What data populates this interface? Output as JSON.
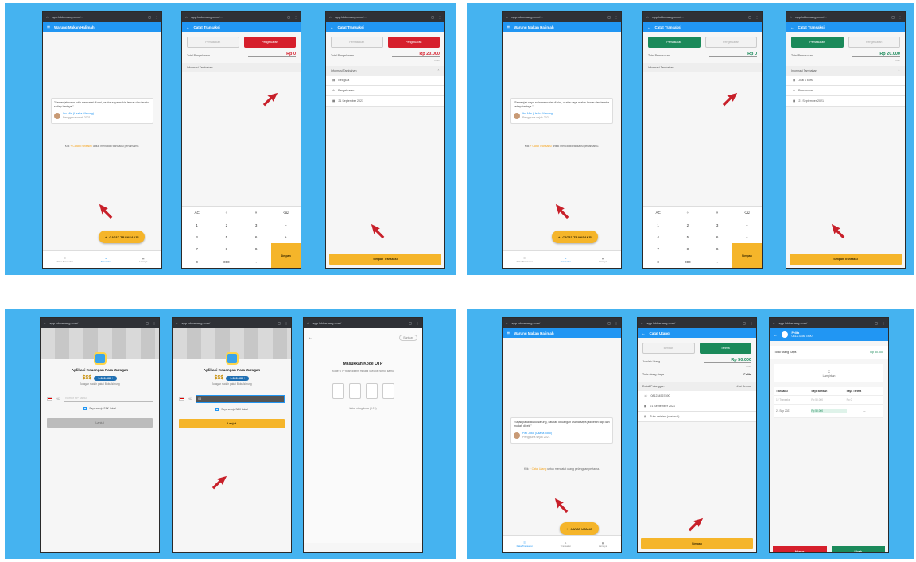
{
  "panel1": {
    "screen1": {
      "url": "app.lokkeuang.com/...",
      "title": "Warung Makan Halimah",
      "quote": "\"Semenjak saya rutin mencatat di sini, usaha saya makin lancar dan teratur setiap harinya.\"",
      "quote_user": "Ibu Mia (Usaha Warung)",
      "quote_user_sub": "Pengguna sejak 2021",
      "note_prefix": "Klik",
      "note_highlight": "+ Catat Transaksi",
      "note_suffix": "untuk mencatat transaksi pertamamu.",
      "fab_label": "CATAT TRANSAKSI",
      "nav": [
        "Data Transaksi",
        "Transaksi",
        "Lainnya"
      ]
    },
    "screen2": {
      "url": "app.lokkeuang.com/...",
      "title": "Catat Transaksi",
      "tab_off": "Pemasukan",
      "tab_on": "Pengeluaran",
      "amount_label": "Total Pengeluaran",
      "amount": "Rp 0",
      "section": "Informasi Tambahan",
      "keys": [
        "AC",
        "÷",
        "×",
        "⌫",
        "1",
        "2",
        "3",
        "−",
        "4",
        "5",
        "6",
        "+",
        "7",
        "8",
        "9",
        "0",
        "000",
        "."
      ],
      "save": "Simpan"
    },
    "screen3": {
      "url": "app.lokkeuang.com/...",
      "title": "Catat Transaksi",
      "tab_off": "Pemasukan",
      "tab_on": "Pengeluaran",
      "amount_label": "Total Pengeluaran",
      "amount": "Rp 20.000",
      "amount_hint": "Ubah",
      "section": "Informasi Tambahan",
      "fields": [
        "Beli gula",
        "Pengeluaran",
        "21 September 2021"
      ],
      "save": "Simpan Transaksi"
    }
  },
  "panel2": {
    "screen1": {
      "url": "app.lokkeuang.com/...",
      "title": "Warung Makan Halimah",
      "quote": "\"Semenjak saya rutin mencatat di sini, usaha saya makin lancar dan teratur setiap harinya.\"",
      "quote_user": "Ibu Mia (Usaha Warung)",
      "quote_user_sub": "Pengguna sejak 2021",
      "note_prefix": "Klik",
      "note_highlight": "+ Catat Transaksi",
      "note_suffix": "untuk mencatat transaksi pertamamu.",
      "fab_label": "CATAT TRANSAKSI",
      "nav": [
        "Data Transaksi",
        "Transaksi",
        "Lainnya"
      ]
    },
    "screen2": {
      "url": "app.lokkeuang.com/...",
      "title": "Catat Transaksi",
      "tab_on": "Pemasukan",
      "tab_off": "Pengeluaran",
      "amount_label": "Total Pemasukan",
      "amount": "Rp 0",
      "section": "Informasi Tambahan",
      "keys": [
        "AC",
        "÷",
        "×",
        "⌫",
        "1",
        "2",
        "3",
        "−",
        "4",
        "5",
        "6",
        "+",
        "7",
        "8",
        "9",
        "0",
        "000",
        "."
      ],
      "save": "Simpan"
    },
    "screen3": {
      "url": "app.lokkeuang.com/...",
      "title": "Catat Transaksi",
      "tab_on": "Pemasukan",
      "tab_off": "Pengeluaran",
      "amount_label": "Total Pemasukan",
      "amount": "Rp 20.000",
      "amount_hint": "Ubah",
      "section": "Informasi Tambahan",
      "fields": [
        "Jual 1 kursi",
        "Pemasukan",
        "21 September 2021"
      ],
      "save": "Simpan Transaksi"
    }
  },
  "panel3": {
    "screen1": {
      "url": "app.lokkeuang.com/...",
      "title": "Aplikasi Keuangan Para Juragan",
      "badge_sym": "$$$",
      "badge": "1.000.000+",
      "sub": "Juragan sudah pakai BukuWarung",
      "country_code": "+62",
      "phone_placeholder": "Nomor HP kamu",
      "check": "Saya setuju S&K Lokal",
      "button": "Lanjut"
    },
    "screen2": {
      "url": "app.lokkeuang.com/...",
      "title": "Aplikasi Keuangan Para Juragan",
      "badge_sym": "$$$",
      "badge": "1.000.000+",
      "sub": "Juragan sudah pakai BukuWarung",
      "country_code": "+62",
      "phone_value": "08",
      "check": "Saya setuju S&K Lokal",
      "button": "Lanjut"
    },
    "screen3": {
      "url": "app.lokkeuang.com/...",
      "back": "←",
      "help": "Bantuan",
      "title": "Masukkan Kode OTP",
      "sub": "Kode OTP telah dikirim melalui SMS ke nomor kamu",
      "resend": "Kirim ulang kode (0:15)"
    }
  },
  "panel4": {
    "screen1": {
      "url": "app.lokkeuang.com/...",
      "title": "Warung Makan Halimah",
      "quote": "\"Sejak pakai BukuWarung, catatan keuangan usaha saya jadi lebih rapi dan mudah dicek.\"",
      "quote_user": "Pak Joko (Usaha Toko)",
      "quote_user_sub": "Pengguna sejak 2021",
      "note_prefix": "Klik",
      "note_highlight": "+ Catat Utang",
      "note_suffix": "untuk mencatat utang pelanggan pertama.",
      "fab_label": "CATAT UTANG",
      "nav": [
        "Data Transaksi",
        "Transaksi",
        "Lainnya"
      ]
    },
    "screen2": {
      "url": "app.lokkeuang.com/...",
      "title": "Catat Utang",
      "tab_off": "Berikan",
      "tab_on": "Terima",
      "amount_label": "Jumlah Utang",
      "amount": "Rp 50.000",
      "amount_hint": "Ubah",
      "row2_label": "Tulis utang siapa",
      "row2_value": "Pelita",
      "section": "Detail Pelanggan",
      "section_right": "Lihat Semua",
      "fields": [
        "081234567890",
        "21 September 2021",
        "Tulis catatan (opsional)"
      ],
      "save": "Simpan"
    },
    "screen3": {
      "url": "app.lokkeuang.com/...",
      "head_name": "Pelita",
      "head_sub": "0812 3456 7890",
      "total_label": "Total Utang Saya",
      "total_value": "Rp 50.000",
      "card_label": "Lampirkan",
      "table_head": [
        "Transaksi",
        "Saya Berikan",
        "Saya Terima"
      ],
      "table_sub": [
        "12 Transaksi",
        "Rp 50.000",
        "Rp 0"
      ],
      "row": [
        "21 Sep 2021",
        "Rp 50.000",
        "—"
      ],
      "btn_delete": "Hapus",
      "btn_edit": "Ubah"
    }
  },
  "colors": {
    "background": "#45b3f0",
    "appbar": "#2196f3",
    "accent": "#f5b52a",
    "expense": "#d61f2c",
    "income": "#1b8a5a",
    "arrow": "#c8202a"
  }
}
